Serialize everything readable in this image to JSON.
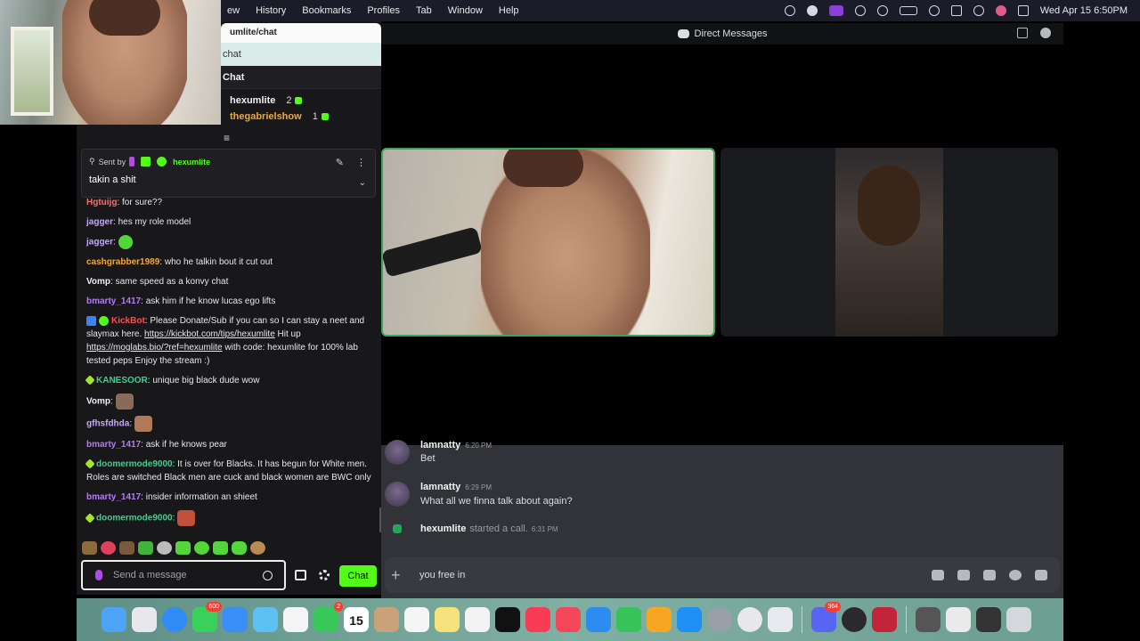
{
  "menubar": {
    "menus": [
      "ew",
      "History",
      "Bookmarks",
      "Profiles",
      "Tab",
      "Window",
      "Help"
    ],
    "clock": "Wed Apr 15  6:50PM"
  },
  "browser": {
    "url": "umlite/chat",
    "url_suggestion": "chat",
    "panel_title": "Chat"
  },
  "gifters": [
    {
      "name": "hexumlite",
      "count": "2",
      "color": "#efeff1"
    },
    {
      "name": "thegabrielshow",
      "count": "1",
      "color": "#f0a73a"
    }
  ],
  "pinned": {
    "sent_by": "Sent by",
    "user": "hexumlite",
    "message": "takin a shit"
  },
  "chat": {
    "cut_user": "Vomp:",
    "messages": [
      {
        "user": "Hgtuijg",
        "color": "#ff6b6b",
        "text": "for sure??"
      },
      {
        "user": "jagger",
        "color": "#c4a6ff",
        "text": "hes my role model"
      },
      {
        "user": "jagger",
        "color": "#c4a6ff",
        "text": "",
        "emote": "#53d63a"
      },
      {
        "user": "cashgrabber1989",
        "color": "#f0a73a",
        "text": "who he talkin bout it cut out"
      },
      {
        "user": "Vomp",
        "color": "#efeff1",
        "text": "same speed as a konvy chat"
      },
      {
        "user": "bmarty_1417",
        "color": "#b57cf0",
        "text": "ask him if he know lucas ego lifts"
      }
    ],
    "kickbot": {
      "user": "KickBot",
      "color": "#ff4d4d",
      "text_a": "Please Donate/Sub if you can so I can stay a neet and slaymax here.",
      "link_a": "https://kickbot.com/tips/hexumlite",
      "text_b": "Hit up",
      "link_b": "https://moglabs.bio/?ref=hexumlite",
      "text_c": "with code: hexumlite for 100% lab tested peps Enjoy the stream :)"
    },
    "messages2": [
      {
        "user": "KANESOOR",
        "color": "#3ecf8e",
        "text": "unique big black dude wow",
        "badge": true
      },
      {
        "user": "Vomp",
        "color": "#efeff1",
        "text": "",
        "emote": "#8a6a5a"
      },
      {
        "user": "gfhsfdhda",
        "color": "#c4a6ff",
        "text": "",
        "emote": "#b07a5a"
      },
      {
        "user": "bmarty_1417",
        "color": "#b57cf0",
        "text": "ask if he knows pear"
      },
      {
        "user": "doomermode9000",
        "color": "#3ecf8e",
        "text": "It is over for Blacks. It has begun for White men. Roles are switched Black men are cuck and black women are BWC only",
        "badge": true
      },
      {
        "user": "bmarty_1417",
        "color": "#b57cf0",
        "text": "insider information an shieet"
      },
      {
        "user": "doomermode9000",
        "color": "#3ecf8e",
        "text": "",
        "emote": "#c0503a",
        "badge": true
      }
    ]
  },
  "send": {
    "placeholder": "Send a message",
    "chat_button": "Chat"
  },
  "discord": {
    "header": "Direct Messages",
    "dm_rows": [
      {
        "name": "lamnatty",
        "time": "6:20 PM",
        "text": "Bet"
      },
      {
        "name": "lamnatty",
        "time": "6:29 PM",
        "text": "What all we finna talk about again?"
      }
    ],
    "call": {
      "name": "hexumlite",
      "text": "started a call.",
      "time": "6:31 PM"
    },
    "composer_value": "you free in"
  },
  "dock": {
    "badge_messages": "600",
    "badge_facetime": "2",
    "calendar_day": "15",
    "badge_discord": "364"
  },
  "colors": {
    "kick_green": "#53fc18",
    "discord_bg": "#313338",
    "speaking_border": "#3ba55d"
  }
}
